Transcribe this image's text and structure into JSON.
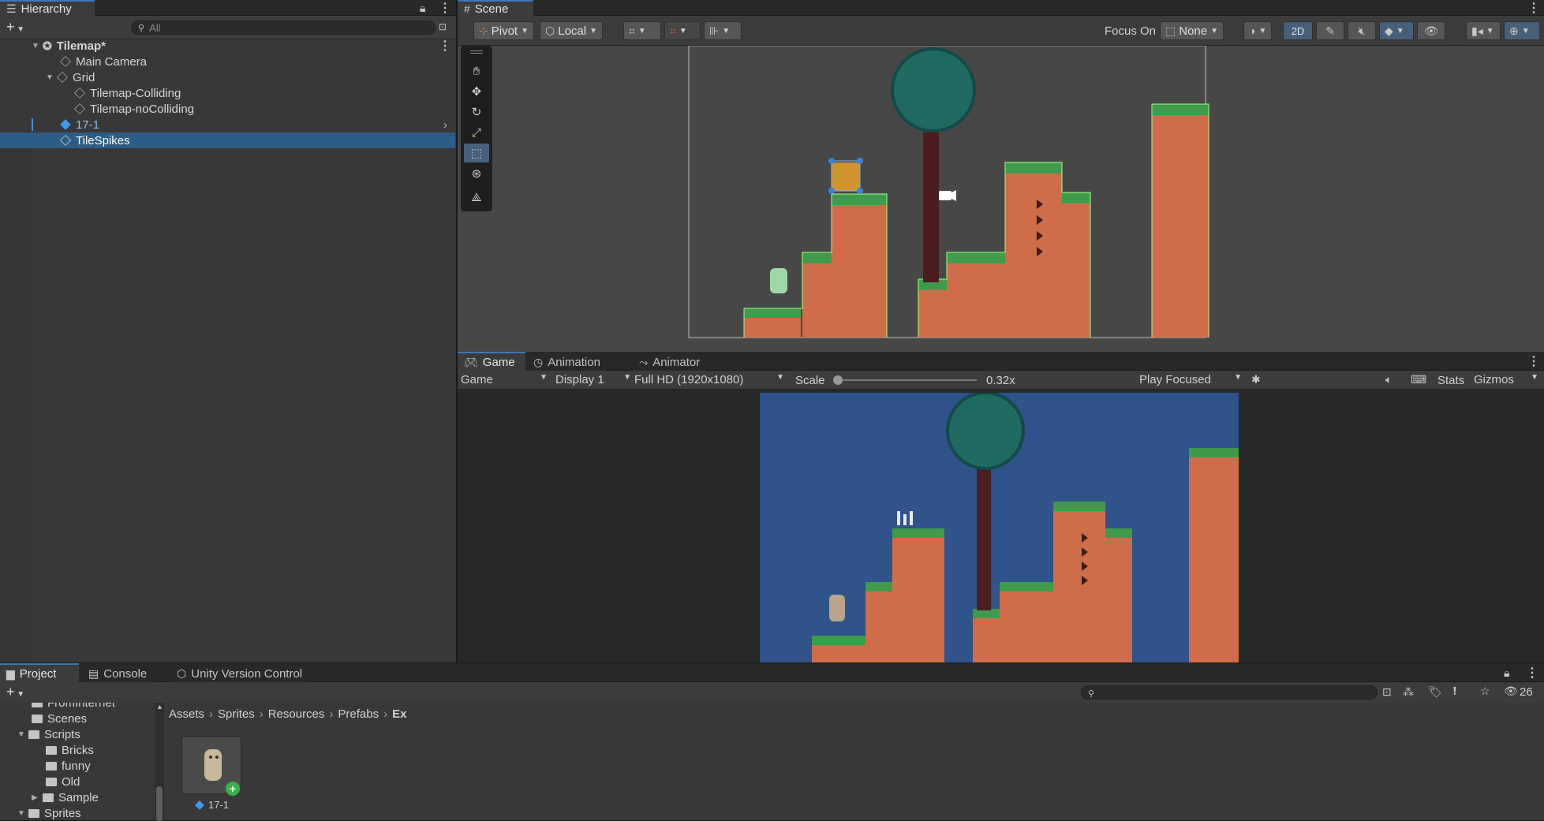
{
  "hierarchy": {
    "tab_label": "Hierarchy",
    "search_placeholder": "All",
    "items": [
      {
        "label": "Tilemap*"
      },
      {
        "label": "Main Camera"
      },
      {
        "label": "Grid"
      },
      {
        "label": "Tilemap-Colliding"
      },
      {
        "label": "Tilemap-noColliding"
      },
      {
        "label": "17-1"
      },
      {
        "label": "TileSpikes"
      }
    ]
  },
  "scene": {
    "tab_label": "Scene",
    "pivot_label": "Pivot",
    "local_label": "Local",
    "focus_on_label": "Focus On",
    "focus_value": "None",
    "mode_2d_label": "2D",
    "tools": [
      "hand",
      "move",
      "rotate",
      "scale",
      "rect",
      "transform",
      "custom"
    ]
  },
  "game": {
    "tabs": [
      "Game",
      "Animation",
      "Animator"
    ],
    "view_label": "Game",
    "display_label": "Display 1",
    "resolution_label": "Full HD (1920x1080)",
    "scale_label": "Scale",
    "scale_value": "0.32x",
    "play_mode_label": "Play Focused",
    "stats_label": "Stats",
    "gizmos_label": "Gizmos",
    "colors": {
      "sky": "#2f538a",
      "ground": "#cf6d4a",
      "grass": "#3f9a4b",
      "tree": "#1f6b62"
    }
  },
  "project": {
    "tabs": [
      "Project",
      "Console",
      "Unity Version Control"
    ],
    "hidden_count": "26",
    "tree": [
      {
        "label": "FromInternet"
      },
      {
        "label": "Scenes"
      },
      {
        "label": "Scripts"
      },
      {
        "label": "Bricks"
      },
      {
        "label": "funny"
      },
      {
        "label": "Old"
      },
      {
        "label": "Sample"
      },
      {
        "label": "Sprites"
      }
    ],
    "breadcrumb": [
      "Assets",
      "Sprites",
      "Resources",
      "Prefabs",
      "Ex"
    ],
    "assets": [
      {
        "label": "17-1"
      }
    ]
  }
}
